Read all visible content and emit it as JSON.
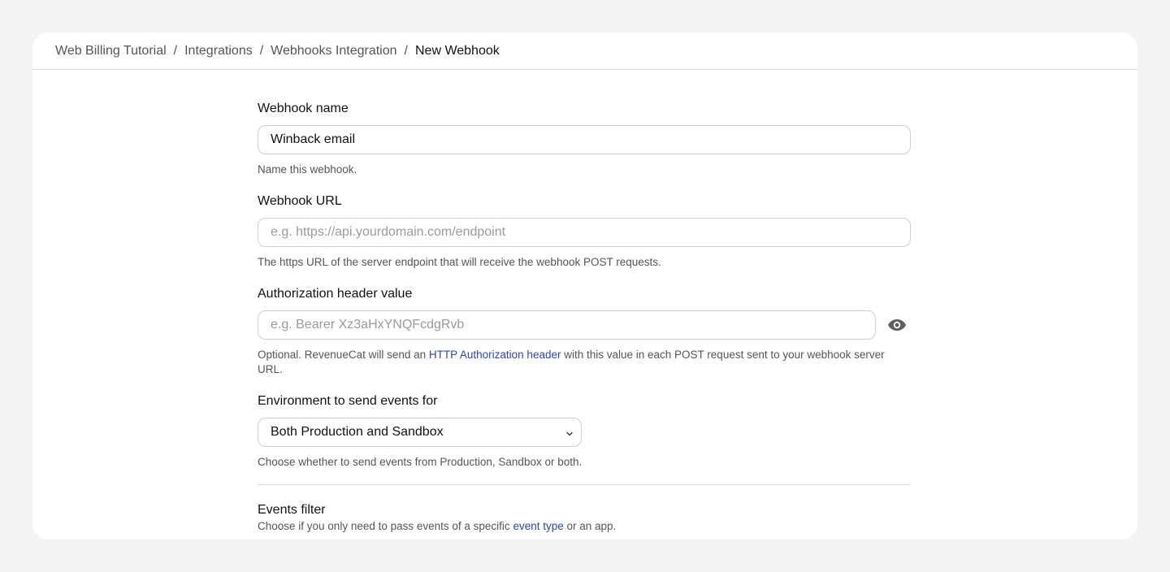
{
  "breadcrumb": {
    "items": [
      "Web Billing Tutorial",
      "Integrations",
      "Webhooks Integration"
    ],
    "current": "New Webhook",
    "separator": "/"
  },
  "form": {
    "webhook_name": {
      "label": "Webhook name",
      "value": "Winback email",
      "help": "Name this webhook."
    },
    "webhook_url": {
      "label": "Webhook URL",
      "value": "",
      "placeholder": "e.g. https://api.yourdomain.com/endpoint",
      "help": "The https URL of the server endpoint that will receive the webhook POST requests."
    },
    "auth_header": {
      "label": "Authorization header value",
      "value": "",
      "placeholder": "e.g. Bearer Xz3aHxYNQFcdgRvb",
      "help_prefix": "Optional. RevenueCat will send an ",
      "help_link": "HTTP Authorization header",
      "help_suffix": " with this value in each POST request sent to your webhook server URL.",
      "toggle_icon": "eye-icon"
    },
    "environment": {
      "label": "Environment to send events for",
      "selected": "Both Production and Sandbox",
      "help": "Choose whether to send events from Production, Sandbox or both.",
      "icon": "chevron-down-icon"
    },
    "events_filter": {
      "title": "Events filter",
      "help_prefix": "Choose if you only need to pass events of a specific ",
      "help_link": "event type",
      "help_suffix": " or an app."
    }
  },
  "colors": {
    "link": "#2d45b5",
    "border": "#cfcfcf",
    "background": "#f4f4f4",
    "card": "#ffffff"
  }
}
